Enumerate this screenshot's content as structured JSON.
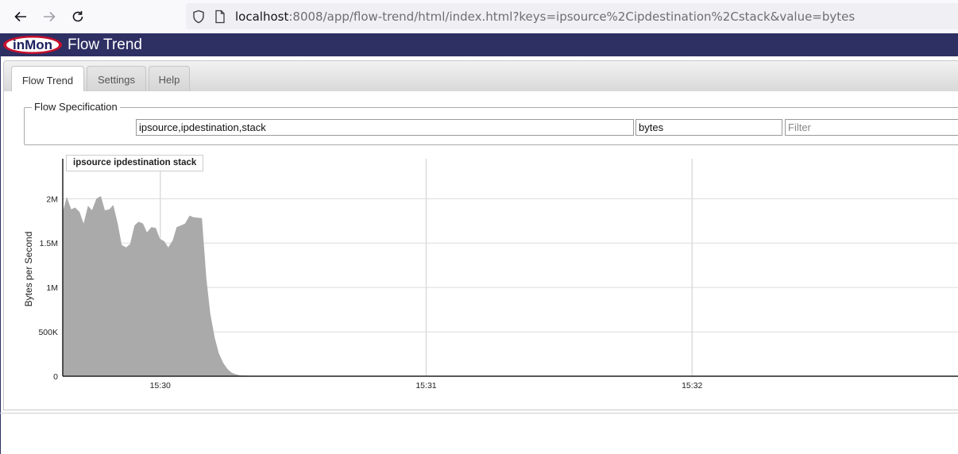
{
  "browser": {
    "url_host": "localhost",
    "url_rest": ":8008/app/flow-trend/html/index.html?keys=ipsource%2Cipdestination%2Cstack&value=bytes"
  },
  "app": {
    "logo_text": "inMon",
    "title": "Flow Trend"
  },
  "tabs": [
    {
      "label": "Flow Trend",
      "active": true
    },
    {
      "label": "Settings",
      "active": false
    },
    {
      "label": "Help",
      "active": false
    }
  ],
  "flow_spec": {
    "legend": "Flow Specification",
    "keys_value": "ipsource,ipdestination,stack",
    "value_value": "bytes",
    "filter_placeholder": "Filter"
  },
  "chart_data": {
    "type": "area",
    "ylabel": "Bytes per Second",
    "legend": "ipsource ipdestination stack",
    "ylim": [
      0,
      2450000
    ],
    "yticks": [
      {
        "label": "0",
        "value": 0
      },
      {
        "label": "500K",
        "value": 500000
      },
      {
        "label": "1M",
        "value": 1000000
      },
      {
        "label": "1.5M",
        "value": 1500000
      },
      {
        "label": "2M",
        "value": 2000000
      }
    ],
    "xlim_seconds": [
      -22,
      180
    ],
    "xticks": [
      {
        "label": "15:30",
        "t": 0
      },
      {
        "label": "15:31",
        "t": 60
      },
      {
        "label": "15:32",
        "t": 120
      }
    ],
    "series_color": "#aaaaaa",
    "series": [
      {
        "name": "ipsource ipdestination stack",
        "points": [
          [
            -22,
            1850000
          ],
          [
            -21.1,
            2020000
          ],
          [
            -20.1,
            1880000
          ],
          [
            -19.2,
            1900000
          ],
          [
            -18.2,
            1850000
          ],
          [
            -17.3,
            1720000
          ],
          [
            -16.3,
            1920000
          ],
          [
            -15.4,
            1870000
          ],
          [
            -14.4,
            2000000
          ],
          [
            -13.4,
            2030000
          ],
          [
            -12.5,
            1870000
          ],
          [
            -11.5,
            1880000
          ],
          [
            -10.6,
            1930000
          ],
          [
            -9.6,
            1720000
          ],
          [
            -8.7,
            1480000
          ],
          [
            -7.7,
            1450000
          ],
          [
            -6.8,
            1490000
          ],
          [
            -5.8,
            1700000
          ],
          [
            -4.9,
            1740000
          ],
          [
            -3.9,
            1720000
          ],
          [
            -3.0,
            1620000
          ],
          [
            -2.0,
            1680000
          ],
          [
            -1.0,
            1670000
          ],
          [
            -0.1,
            1550000
          ],
          [
            0.9,
            1520000
          ],
          [
            1.8,
            1450000
          ],
          [
            2.8,
            1530000
          ],
          [
            3.7,
            1680000
          ],
          [
            4.7,
            1700000
          ],
          [
            5.6,
            1720000
          ],
          [
            6.6,
            1810000
          ],
          [
            7.5,
            1790000
          ],
          [
            9.4,
            1780000
          ],
          [
            10.4,
            1100000
          ],
          [
            11.3,
            700000
          ],
          [
            12.3,
            430000
          ],
          [
            13.2,
            260000
          ],
          [
            14.2,
            150000
          ],
          [
            15.2,
            80000
          ],
          [
            16.1,
            40000
          ],
          [
            17.1,
            20000
          ],
          [
            18.0,
            10000
          ],
          [
            20.0,
            5000
          ],
          [
            25.0,
            2000
          ],
          [
            35.0,
            0
          ],
          [
            180,
            0
          ]
        ]
      }
    ],
    "grid": true
  }
}
